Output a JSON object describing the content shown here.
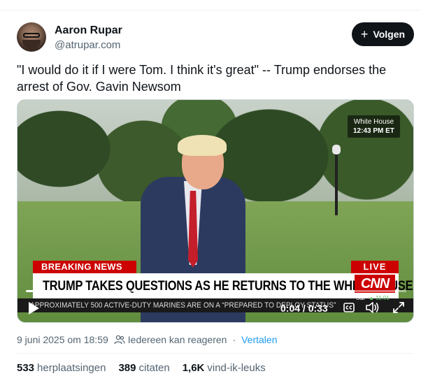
{
  "author": {
    "name": "Aaron Rupar",
    "handle": "@atrupar.com"
  },
  "follow_button": {
    "label": "Volgen",
    "icon": "plus-icon"
  },
  "post": {
    "text": "\"I would do it if I were Tom. I think it's great\" -- Trump endorses the arrest of Gov. Gavin Newsom"
  },
  "video": {
    "location_label": "White House",
    "time_label": "12:43 PM ET",
    "breaking_label": "BREAKING NEWS",
    "live_label": "LIVE",
    "headline": "TRUMP TAKES QUESTIONS AS HE RETURNS TO THE WHITE HOUSE",
    "network_logo": "CNN",
    "ticker": "APPROXIMATELY 500 ACTIVE-DUTY MARINES ARE ON A “PREPARED TO DEPLOY STATUS”",
    "market_label": "S&P",
    "market_value": "▲ 11.01",
    "elapsed": "0:04",
    "duration": "0:33",
    "time_display": "0:04 / 0:33",
    "progress_fraction": 0.12,
    "icons": [
      "play-icon",
      "captions-icon",
      "volume-icon",
      "fullscreen-icon"
    ]
  },
  "meta": {
    "date": "9 juni 2025 om 18:59",
    "reply_setting": "Iedereen kan reageren",
    "separator": "·",
    "translate": "Vertalen"
  },
  "stats": [
    {
      "value": "533",
      "label": "herplaatsingen"
    },
    {
      "value": "389",
      "label": "citaten"
    },
    {
      "value": "1,6K",
      "label": "vind-ik-leuks"
    }
  ],
  "colors": {
    "accent_link": "#1d9bf0",
    "button_bg": "#0f1419",
    "cnn_red": "#cc0000",
    "secondary_text": "#536471"
  }
}
